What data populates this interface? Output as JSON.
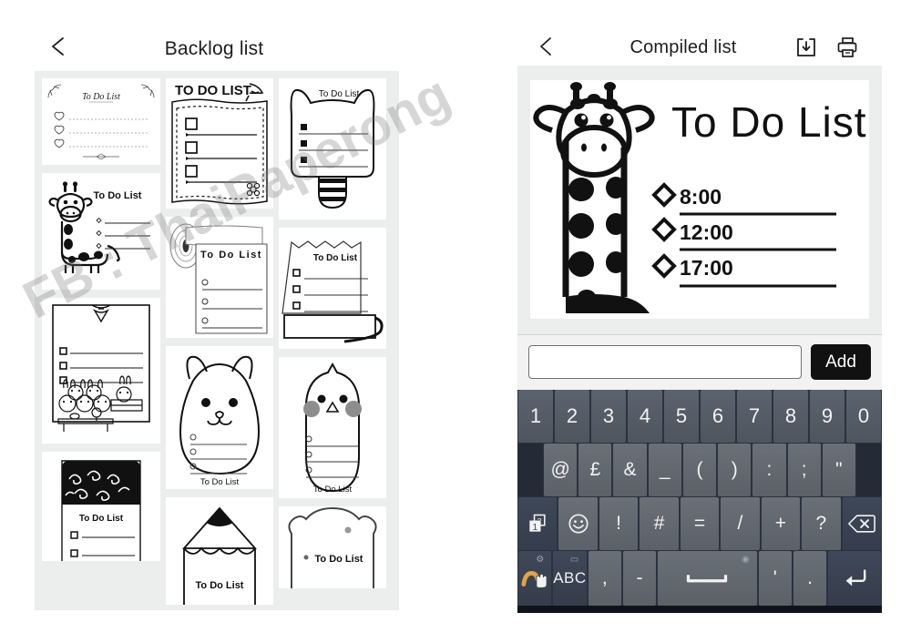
{
  "backlog": {
    "title": "Backlog list",
    "back_icon": "chevron-left-icon",
    "templates": [
      {
        "id": "t1",
        "label": "To Do List",
        "style": "ornate-corners-hearts",
        "column": 1
      },
      {
        "id": "t2",
        "label": "To Do List",
        "style": "giraffe",
        "column": 1
      },
      {
        "id": "t3",
        "label": "",
        "style": "bunnies-frame",
        "column": 1
      },
      {
        "id": "t4",
        "label": "To Do List",
        "style": "black-swirl-top",
        "column": 1
      },
      {
        "id": "t5",
        "label": "TO DO LIST",
        "style": "notebook-quill",
        "column": 2
      },
      {
        "id": "t6",
        "label": "To Do List",
        "style": "paper-roll",
        "column": 2
      },
      {
        "id": "t7",
        "label": "To Do List",
        "style": "cat-face",
        "column": 2
      },
      {
        "id": "t8",
        "label": "To Do List",
        "style": "pencil",
        "column": 2
      },
      {
        "id": "t9",
        "label": "To Do List",
        "style": "bee-cat-head",
        "column": 3
      },
      {
        "id": "t10",
        "label": "To Do List",
        "style": "torn-note-tape",
        "column": 3
      },
      {
        "id": "t11",
        "label": "To Do List",
        "style": "chick",
        "column": 3
      },
      {
        "id": "t12",
        "label": "To Do List",
        "style": "bread-slice",
        "column": 3
      }
    ]
  },
  "compiled": {
    "title": "Compiled list",
    "back_icon": "chevron-left-icon",
    "download_icon": "download-icon",
    "print_icon": "printer-icon",
    "card": {
      "heading": "To Do List",
      "artwork": "giraffe",
      "rows": [
        {
          "marker": "diamond",
          "time": "8:00",
          "text": ""
        },
        {
          "marker": "diamond",
          "time": "12:00",
          "text": ""
        },
        {
          "marker": "diamond",
          "time": "17:00",
          "text": ""
        }
      ]
    },
    "input": {
      "value": "",
      "placeholder": ""
    },
    "add_label": "Add"
  },
  "watermark": {
    "text": "FB : ThaiPaperong"
  },
  "keyboard": {
    "rows": [
      {
        "id": "row-digits",
        "keys": [
          {
            "label": "1",
            "name": "key-1",
            "tone": "light"
          },
          {
            "label": "2",
            "name": "key-2",
            "tone": "light"
          },
          {
            "label": "3",
            "name": "key-3",
            "tone": "light"
          },
          {
            "label": "4",
            "name": "key-4",
            "tone": "light"
          },
          {
            "label": "5",
            "name": "key-5",
            "tone": "light"
          },
          {
            "label": "6",
            "name": "key-6",
            "tone": "light"
          },
          {
            "label": "7",
            "name": "key-7",
            "tone": "light"
          },
          {
            "label": "8",
            "name": "key-8",
            "tone": "light"
          },
          {
            "label": "9",
            "name": "key-9",
            "tone": "light"
          },
          {
            "label": "0",
            "name": "key-0",
            "tone": "light"
          }
        ]
      },
      {
        "id": "row-symbols-1",
        "keys": [
          {
            "label": "@",
            "name": "key-at",
            "tone": "mid"
          },
          {
            "label": "£",
            "name": "key-pound",
            "tone": "mid"
          },
          {
            "label": "&",
            "name": "key-ampersand",
            "tone": "mid"
          },
          {
            "label": "_",
            "name": "key-underscore",
            "tone": "mid"
          },
          {
            "label": "(",
            "name": "key-paren-open",
            "tone": "mid"
          },
          {
            "label": ")",
            "name": "key-paren-close",
            "tone": "mid"
          },
          {
            "label": ":",
            "name": "key-colon",
            "tone": "mid"
          },
          {
            "label": ";",
            "name": "key-semicolon",
            "tone": "mid"
          },
          {
            "label": "\"",
            "name": "key-quote",
            "tone": "mid"
          }
        ]
      },
      {
        "id": "row-symbols-2",
        "keys": [
          {
            "label": "",
            "name": "key-symbol-page-toggle",
            "tone": "dark",
            "icon": "page-1-2-icon"
          },
          {
            "label": "☺",
            "name": "key-emoji",
            "tone": "mid"
          },
          {
            "label": "!",
            "name": "key-exclamation",
            "tone": "mid"
          },
          {
            "label": "#",
            "name": "key-hash",
            "tone": "mid"
          },
          {
            "label": "=",
            "name": "key-equals",
            "tone": "mid"
          },
          {
            "label": "/",
            "name": "key-slash",
            "tone": "mid"
          },
          {
            "label": "+",
            "name": "key-plus",
            "tone": "mid"
          },
          {
            "label": "?",
            "name": "key-question",
            "tone": "mid"
          },
          {
            "label": "",
            "name": "key-backspace",
            "tone": "dark",
            "icon": "backspace-icon"
          }
        ]
      },
      {
        "id": "row-bottom",
        "keys": [
          {
            "label": "",
            "name": "key-swipe-input",
            "tone": "dark",
            "icon": "swipe-hand-icon"
          },
          {
            "label": "ABC",
            "name": "key-abc",
            "tone": "dark"
          },
          {
            "label": ",",
            "name": "key-comma",
            "tone": "mid"
          },
          {
            "label": "-",
            "name": "key-hyphen",
            "tone": "mid"
          },
          {
            "label": "",
            "name": "key-space",
            "tone": "mid",
            "icon": "space-icon"
          },
          {
            "label": "'",
            "name": "key-apostrophe",
            "tone": "mid"
          },
          {
            "label": ".",
            "name": "key-period",
            "tone": "mid"
          },
          {
            "label": "",
            "name": "key-enter",
            "tone": "dark",
            "icon": "enter-icon"
          }
        ]
      }
    ]
  },
  "colors": {
    "panel_bg": "#eceded",
    "accent_dark": "#111111",
    "keyboard_bg": "#2b3240",
    "key_light": "#5b636e",
    "key_mid": "#6a7077",
    "key_dark": "#3d4656",
    "swipe_orange": "#e0a44a"
  }
}
